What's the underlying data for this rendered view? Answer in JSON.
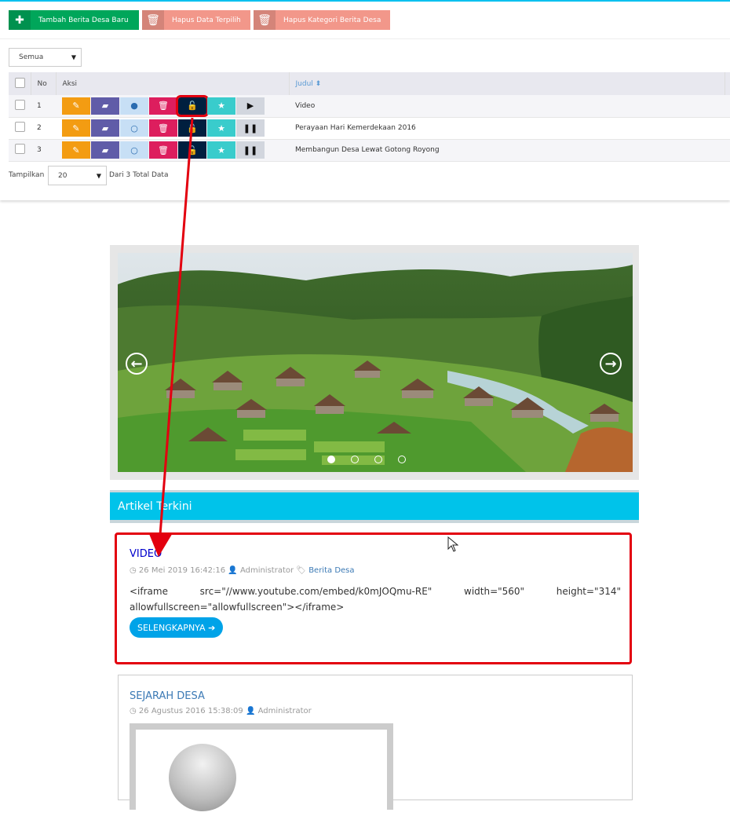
{
  "toolbar": {
    "add_label": "Tambah Berita Desa Baru",
    "delete_selected_label": "Hapus Data Terpilih",
    "delete_category_label": "Hapus Kategori Berita Desa"
  },
  "filter": {
    "selected": "Semua"
  },
  "table": {
    "headers": {
      "no": "No",
      "aksi": "Aksi",
      "judul": "Judul"
    },
    "rows": [
      {
        "no": "1",
        "judul": "Video"
      },
      {
        "no": "2",
        "judul": "Perayaan Hari Kemerdekaan 2016"
      },
      {
        "no": "3",
        "judul": "Membangun Desa Lewat Gotong Royong"
      }
    ]
  },
  "pagination": {
    "show_label": "Tampilkan",
    "per_page": "20",
    "total_text": "Dari 3 Total Data"
  },
  "slider": {
    "active_index": 1,
    "count": 4
  },
  "section": {
    "title": "Artikel Terkini"
  },
  "article1": {
    "title": "VIDEO",
    "date": "26 Mei 2019 16:42:16",
    "author": "Administrator",
    "category": "Berita Desa",
    "body": "<iframe src=\"//www.youtube.com/embed/k0mJOQmu-RE\" width=\"560\" height=\"314\" allowfullscreen=\"allowfullscreen\"></iframe>",
    "more_label": "SELENGKAPNYA"
  },
  "article2": {
    "title": "SEJARAH DESA",
    "date": "26 Agustus 2016 15:38:09",
    "author": "Administrator"
  },
  "colors": {
    "accent": "#00c3ea",
    "highlight": "#e3000f",
    "green": "#00a65a",
    "red_light": "#f2978a"
  }
}
